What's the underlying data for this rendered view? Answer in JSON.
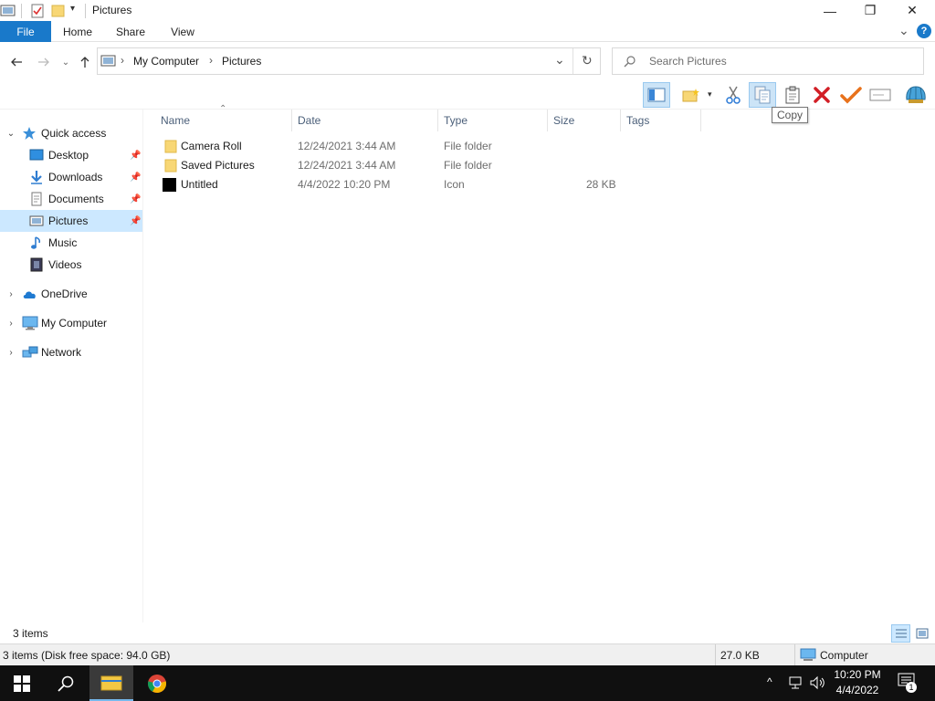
{
  "window": {
    "title": "Pictures",
    "minimize_glyph": "—",
    "maximize_glyph": "❐",
    "close_glyph": "✕"
  },
  "ribbon": {
    "tabs": [
      "File",
      "Home",
      "Share",
      "View"
    ],
    "expand_glyph": "⌄",
    "help_glyph": "?"
  },
  "address": {
    "segments": [
      "My Computer",
      "Pictures"
    ],
    "separator": "›",
    "dropdown_glyph": "⌄",
    "refresh_glyph": "↻"
  },
  "search": {
    "placeholder": "Search Pictures"
  },
  "tooltip": "Copy",
  "navpane": {
    "items": [
      {
        "label": "Quick access",
        "icon": "star-icon",
        "level": 0,
        "expanded": true
      },
      {
        "label": "Desktop",
        "icon": "desktop-icon",
        "level": 1,
        "pinned": true
      },
      {
        "label": "Downloads",
        "icon": "download-icon",
        "level": 1,
        "pinned": true
      },
      {
        "label": "Documents",
        "icon": "document-icon",
        "level": 1,
        "pinned": true
      },
      {
        "label": "Pictures",
        "icon": "pictures-icon",
        "level": 1,
        "pinned": true,
        "selected": true
      },
      {
        "label": "Music",
        "icon": "music-icon",
        "level": 1
      },
      {
        "label": "Videos",
        "icon": "video-icon",
        "level": 1
      },
      {
        "label": "OneDrive",
        "icon": "cloud-icon",
        "level": 0
      },
      {
        "label": "My Computer",
        "icon": "computer-icon",
        "level": 0
      },
      {
        "label": "Network",
        "icon": "network-icon",
        "level": 0
      }
    ]
  },
  "columns": [
    "Name",
    "Date",
    "Type",
    "Size",
    "Tags"
  ],
  "files": [
    {
      "name": "Camera Roll",
      "date": "12/24/2021 3:44 AM",
      "type": "File folder",
      "size": "",
      "icon": "folder-icon"
    },
    {
      "name": "Saved Pictures",
      "date": "12/24/2021 3:44 AM",
      "type": "File folder",
      "size": "",
      "icon": "folder-icon"
    },
    {
      "name": "Untitled",
      "date": "4/4/2022 10:20 PM",
      "type": "Icon",
      "size": "28 KB",
      "icon": "black-icon-file"
    }
  ],
  "status": {
    "item_count": "3 items",
    "details": "3 items (Disk free space: 94.0 GB)",
    "size": "27.0 KB",
    "location": "Computer"
  },
  "taskbar": {
    "time": "10:20 PM",
    "date": "4/4/2022",
    "notification_count": "1"
  },
  "colors": {
    "accent": "#1979ca",
    "selection": "#cce8ff",
    "taskbar": "#101010"
  }
}
